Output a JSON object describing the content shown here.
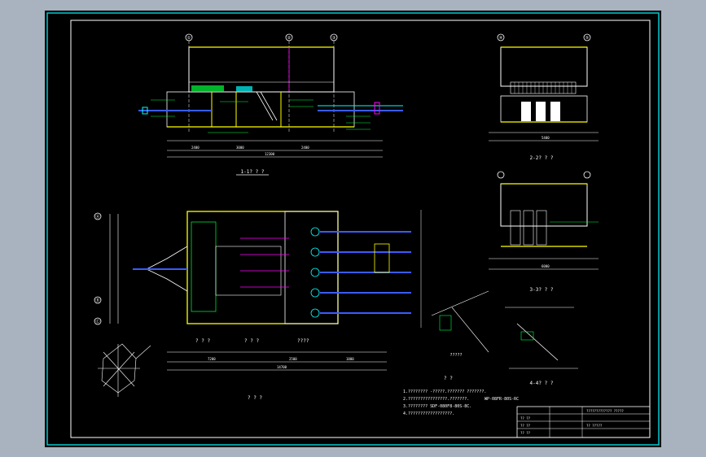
{
  "colors": {
    "background": "#a9b3bf",
    "paper": "#000000",
    "border": "#00c8d0",
    "line": "#ffffff",
    "green": "#00ff3c",
    "yellow": "#ffff00",
    "cyan": "#00ffff",
    "magenta": "#ff00ff",
    "blue": "#3a5cff"
  },
  "section_titles": {
    "s11": "1-1? ? ?",
    "s22": "2-2? ? ?",
    "s33": "3-3? ? ?",
    "s44": "4-4? ? ?",
    "plan_a": "? ? ?",
    "plan_b": "? ? ?",
    "plan_c": "????",
    "plan_main": "? ? ?",
    "detail": "?????"
  },
  "axis_labels": {
    "top_1": "①",
    "top_2": "②",
    "top_3": "③",
    "top_4": "④",
    "top_5": "⑤",
    "side_a": "Ⓐ",
    "side_b": "Ⓑ",
    "side_c": "Ⓒ"
  },
  "notes": {
    "heading": "? ?",
    "line1": "1.????????  -?????.??????? ???????.",
    "line2": "2.????????????????.???????.",
    "line3": "3.????????  SDF-080F8-80S-8C.",
    "line4": "4.??????????????????.",
    "tag": "WP-08FR-80S-RC"
  },
  "title_block": {
    "project": "????????????? ?????",
    "drawing_no": "?? ?????",
    "r1": "?? ??",
    "r2": "?? ??",
    "r3": "?? ??"
  },
  "dimensions": {
    "d1": "2400",
    "d2": "3000",
    "d3": "2400",
    "d4": "12300",
    "d5": "5400",
    "d6": "6000",
    "d7": "7200",
    "d8": "2500",
    "d9": "1800",
    "d10": "14700"
  }
}
